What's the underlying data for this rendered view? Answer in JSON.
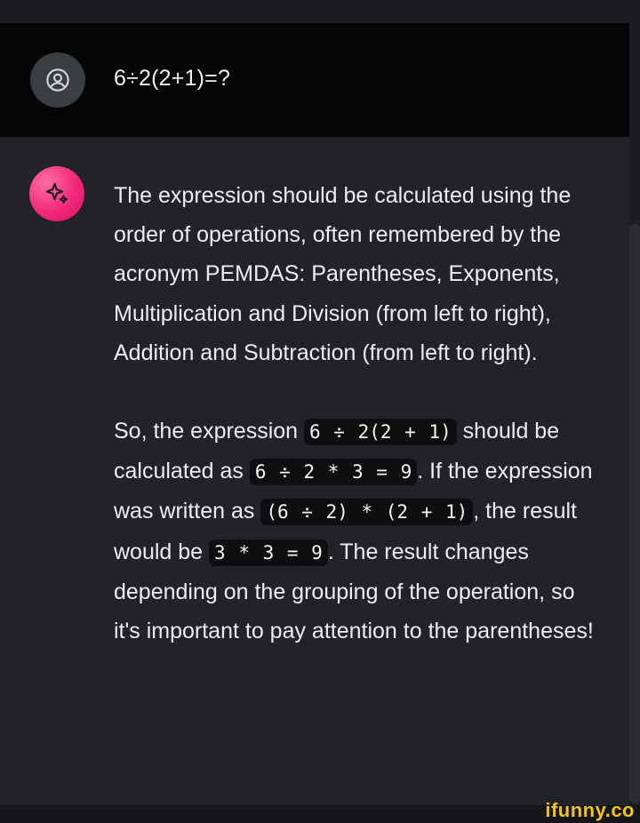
{
  "user_message": {
    "text": "6÷2(2+1)=?"
  },
  "assistant_message": {
    "paragraph1": "The expression should be calculated using the order of operations, often remembered by the acronym PEMDAS: Parentheses, Exponents, Multiplication and Division (from left to right), Addition and Subtraction (from left to right).",
    "p2_text1": "So, the expression ",
    "p2_code1": "6 ÷ 2(2 + 1)",
    "p2_text2": " should be calculated as ",
    "p2_code2": "6 ÷ 2 * 3 = 9",
    "p2_text3": ". If the expression was written as ",
    "p2_code3": "(6 ÷ 2) * (2 + 1)",
    "p2_text4": ", the result would be ",
    "p2_code4": "3 * 3 = 9",
    "p2_text5": ". The result changes depending on the grouping of the operation, so it's important to pay attention to the parentheses!"
  },
  "icons": {
    "user_avatar": "user-circle-icon",
    "assistant_avatar": "sparkle-icon"
  },
  "colors": {
    "user_bg": "#050505",
    "assistant_bg": "#212328",
    "avatar_accent": "#f2287a",
    "watermark": "#f2c40e"
  },
  "watermark": "ifunny.co"
}
